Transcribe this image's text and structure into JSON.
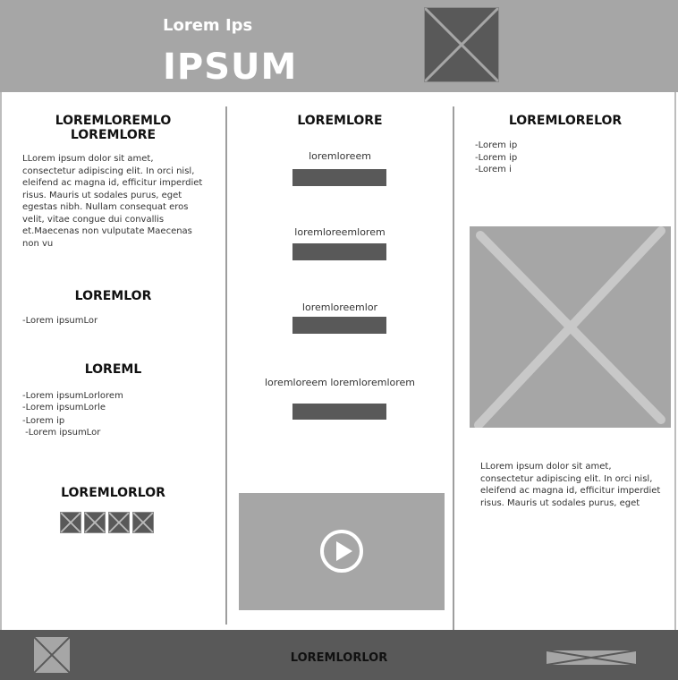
{
  "header": {
    "subtitle": "Lorem Ips",
    "title": "IPSUM",
    "logo_icon": "image-placeholder-icon"
  },
  "left": {
    "section1": {
      "title_line1": "LOREMLOREMLO",
      "title_line2": "LOREMLORE",
      "body_lines": [
        "LLorem ipsum dolor sit amet,",
        "consectetur adipiscing elit. In orci nisl,",
        "eleifend ac magna id, efficitur imperdiet",
        "risus. Mauris ut sodales purus, eget",
        "egestas nibh. Nullam consequat eros",
        "velit, vitae congue dui convallis",
        "et.Maecenas non vulputate Maecenas",
        "non vu"
      ]
    },
    "section2": {
      "title": "LOREMLOR",
      "items": [
        "-Lorem ipsumLor"
      ]
    },
    "section3": {
      "title": "LOREML",
      "items": [
        "-Lorem ipsumLorlorem",
        "-Lorem ipsumLorle",
        "-Lorem ip",
        " -Lorem ipsumLor"
      ]
    },
    "section4": {
      "title": "LOREMLORLOR",
      "thumb_icons": [
        "image-placeholder-icon",
        "image-placeholder-icon",
        "image-placeholder-icon",
        "image-placeholder-icon"
      ]
    }
  },
  "middle": {
    "title": "LOREMLORE",
    "fields": [
      {
        "label": "loremloreem"
      },
      {
        "label": "loremloreemlorem"
      },
      {
        "label": "loremloreemlor"
      },
      {
        "label": "loremloreem loremloremlorem"
      }
    ],
    "video_icon": "play-icon"
  },
  "right": {
    "title": "LOREMLORELOR",
    "items": [
      "-Lorem ip",
      "-Lorem ip",
      "-Lorem i"
    ],
    "image_icon": "image-placeholder-icon",
    "body_lines": [
      "LLorem ipsum dolor sit amet,",
      "consectetur adipiscing elit. In orci nisl,",
      "eleifend ac magna id, efficitur imperdiet",
      "risus. Mauris ut sodales purus, eget"
    ]
  },
  "footer": {
    "title": "LOREMLORLOR",
    "left_icon": "image-placeholder-icon",
    "right_icon": "image-placeholder-icon"
  }
}
